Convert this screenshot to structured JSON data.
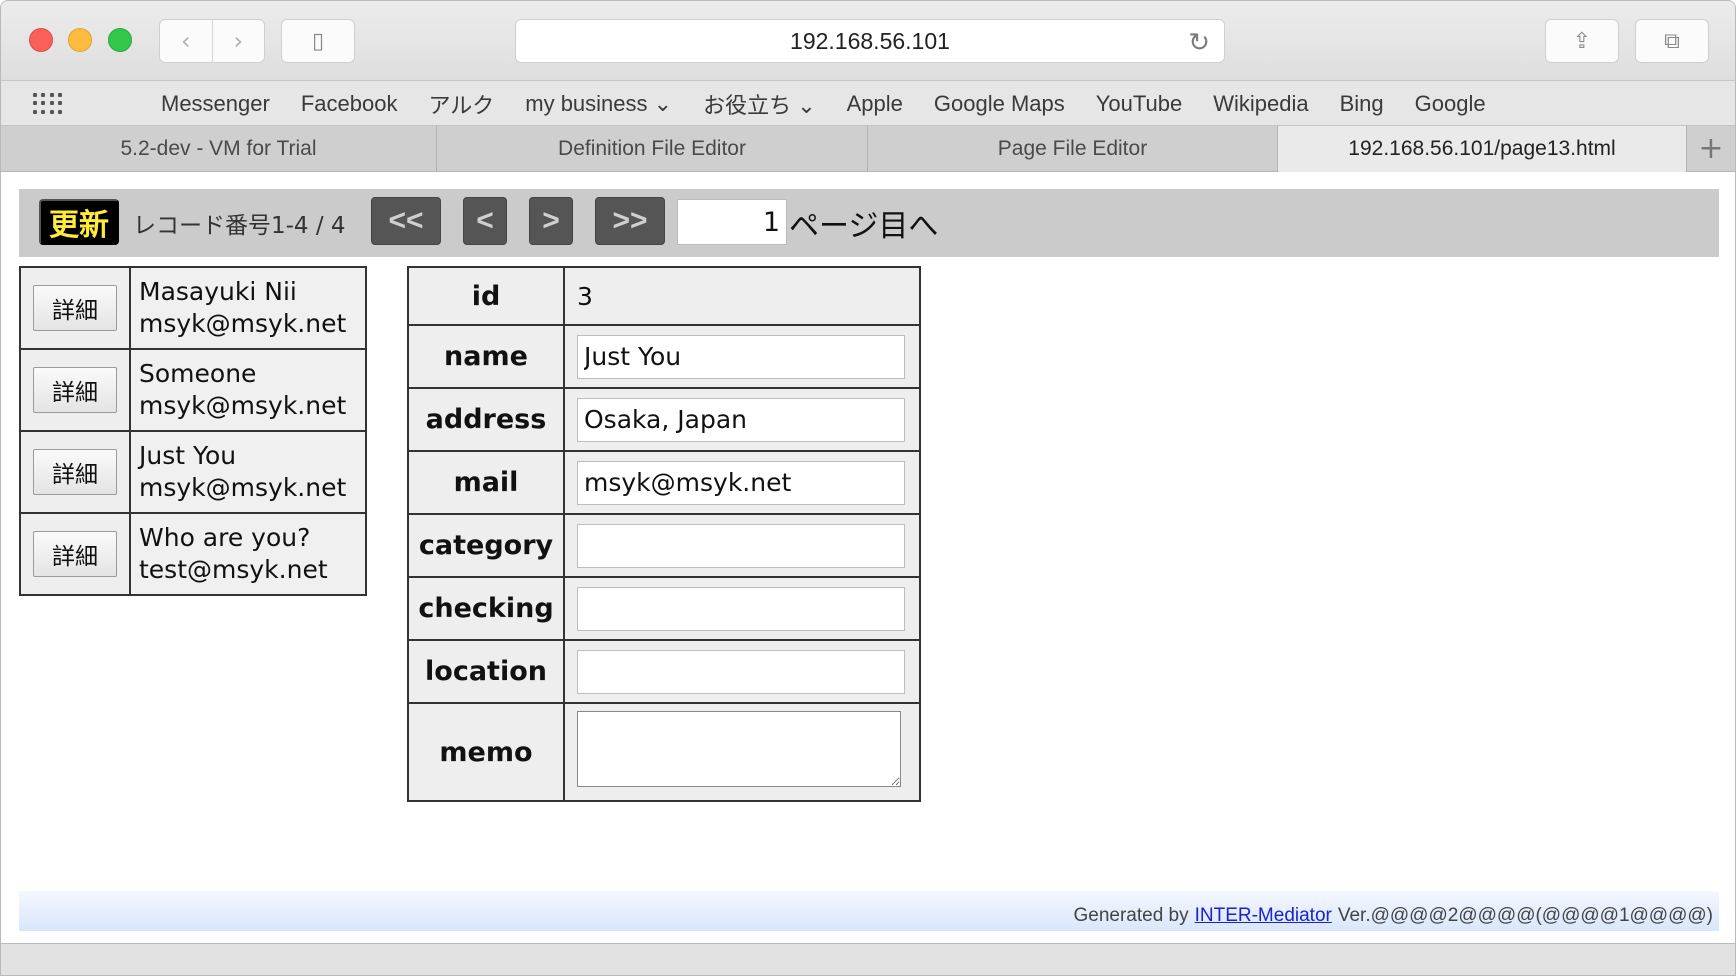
{
  "browser": {
    "url": "192.168.56.101",
    "bookmarks": [
      "Messenger",
      "Facebook",
      "アルク",
      "my business ⌄",
      "お役立ち ⌄",
      "Apple",
      "Google Maps",
      "YouTube",
      "Wikipedia",
      "Bing",
      "Google"
    ],
    "tabs": [
      {
        "label": "5.2-dev - VM for Trial",
        "active": false
      },
      {
        "label": "Definition File Editor",
        "active": false
      },
      {
        "label": "Page File Editor",
        "active": false
      },
      {
        "label": "192.168.56.101/page13.html",
        "active": true
      }
    ],
    "icons": {
      "back": "‹",
      "forward": "›",
      "sidebar": "▯",
      "reload": "↻",
      "share": "⇪",
      "tabs": "⧉",
      "new_tab": "+"
    }
  },
  "navigation": {
    "update_label": "更新",
    "record_info": "レコード番号1-4 / 4",
    "first_label": "<<",
    "prev_label": "<",
    "next_label": ">",
    "last_label": ">>",
    "page_value": "1",
    "page_suffix": "ページ目へ"
  },
  "list": {
    "detail_label": "詳細",
    "rows": [
      {
        "name": "Masayuki Nii",
        "mail": "msyk@msyk.net"
      },
      {
        "name": "Someone",
        "mail": "msyk@msyk.net"
      },
      {
        "name": "Just You",
        "mail": "msyk@msyk.net"
      },
      {
        "name": "Who are you?",
        "mail": "test@msyk.net"
      }
    ]
  },
  "detail": {
    "id_label": "id",
    "id_value": "3",
    "name_label": "name",
    "name_value": "Just You",
    "address_label": "address",
    "address_value": "Osaka, Japan",
    "mail_label": "mail",
    "mail_value": "msyk@msyk.net",
    "category_label": "category",
    "category_value": "",
    "checking_label": "checking",
    "checking_value": "",
    "location_label": "location",
    "location_value": "",
    "memo_label": "memo",
    "memo_value": ""
  },
  "footer": {
    "prefix": "Generated by",
    "link": "INTER-Mediator",
    "version": "Ver.@@@@2@@@@(@@@@1@@@@)"
  }
}
